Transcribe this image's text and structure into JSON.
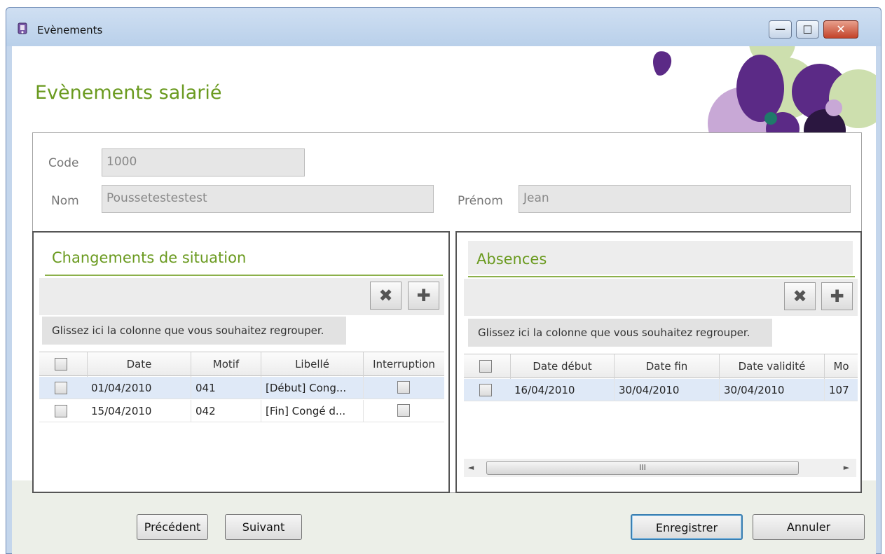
{
  "window": {
    "title": "Evènements",
    "minimize_glyph": "—",
    "maximize_glyph": "□",
    "close_glyph": "✕"
  },
  "page": {
    "title": "Evènements salarié"
  },
  "employee": {
    "code_label": "Code",
    "code_value": "1000",
    "nom_label": "Nom",
    "nom_value": "Poussetestestest",
    "prenom_label": "Prénom",
    "prenom_value": "Jean"
  },
  "situation": {
    "title": "Changements de situation",
    "delete_icon": "✖",
    "add_icon": "✚",
    "group_hint": "Glissez ici la colonne que vous souhaitez regrouper.",
    "columns": [
      "Date",
      "Motif",
      "Libellé",
      "Interruption"
    ],
    "rows": [
      {
        "date": "01/04/2010",
        "motif": "041",
        "libelle": "[Début] Cong...",
        "interruption": false
      },
      {
        "date": "15/04/2010",
        "motif": "042",
        "libelle": "[Fin] Congé d...",
        "interruption": false
      }
    ]
  },
  "absences": {
    "title": "Absences",
    "delete_icon": "✖",
    "add_icon": "✚",
    "group_hint": "Glissez ici la colonne que vous souhaitez regrouper.",
    "columns": [
      "Date début",
      "Date fin",
      "Date validité",
      "Mo"
    ],
    "rows": [
      {
        "date_debut": "16/04/2010",
        "date_fin": "30/04/2010",
        "date_validite": "30/04/2010",
        "motif": "107"
      }
    ],
    "scroll_left": "◄",
    "scroll_right": "►",
    "scroll_grip": "III"
  },
  "buttons": {
    "precedent": "Précédent",
    "suivant": "Suivant",
    "enregistrer": "Enregistrer",
    "annuler": "Annuler"
  },
  "colors": {
    "accent_green": "#6a9a1f",
    "purple": "#5b2a86",
    "lilac": "#c8a8d6",
    "pale_green": "#cddfae"
  }
}
